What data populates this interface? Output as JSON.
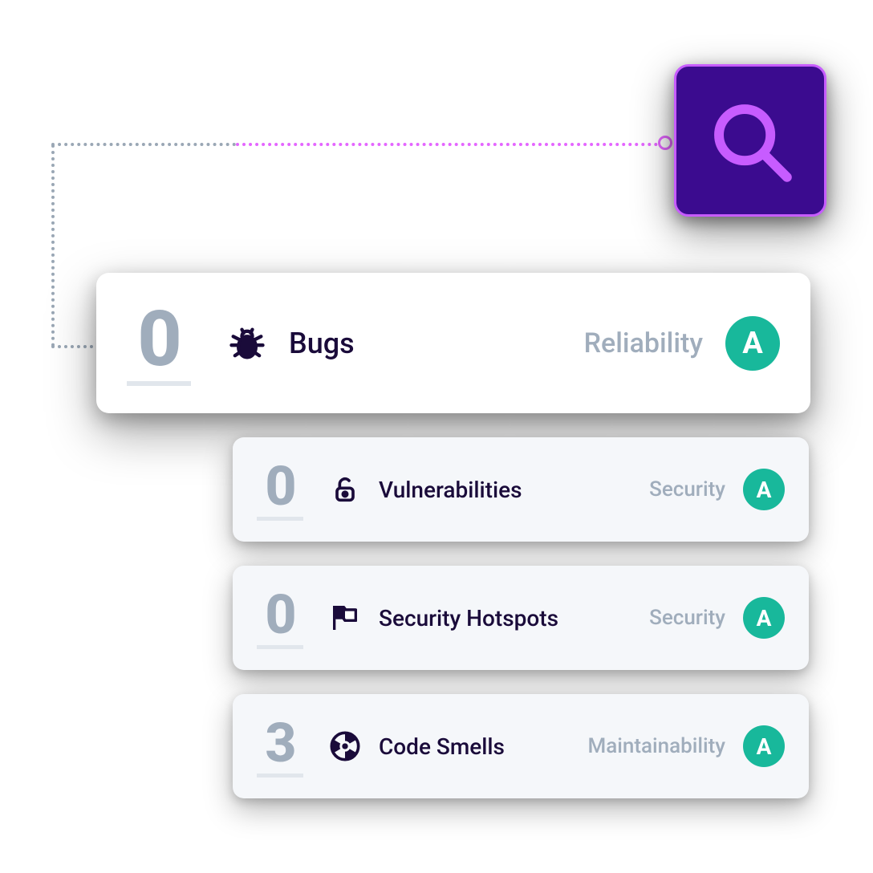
{
  "accent_purple": "#3b0b8f",
  "accent_pink": "#e466ff",
  "grade_green": "#18b89b",
  "search": {
    "icon": "search-icon"
  },
  "metrics": [
    {
      "count": "0",
      "icon": "bug-icon",
      "label": "Bugs",
      "category": "Reliability",
      "grade": "A"
    },
    {
      "count": "0",
      "icon": "unlock-icon",
      "label": "Vulnerabilities",
      "category": "Security",
      "grade": "A"
    },
    {
      "count": "0",
      "icon": "flag-icon",
      "label": "Security Hotspots",
      "category": "Security",
      "grade": "A"
    },
    {
      "count": "3",
      "icon": "radiation-icon",
      "label": "Code Smells",
      "category": "Maintainability",
      "grade": "A"
    }
  ]
}
